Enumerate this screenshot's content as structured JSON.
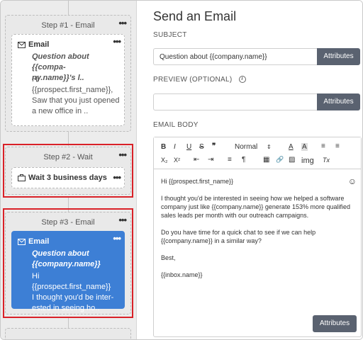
{
  "sequence": {
    "step1": {
      "header": "Step #1 - Email",
      "card_title": "Email",
      "subject_line1": "Question about {{compa-",
      "subject_line2": "ny.name}}'s l..",
      "body_line1": "Hi",
      "body_line2": "{{prospect.first_name}},",
      "body_line3": "Saw that you just opened",
      "body_line4": "a new office in .."
    },
    "step2": {
      "header": "Step #2 - Wait",
      "card_title": "Wait 3 business days"
    },
    "step3": {
      "header": "Step #3 - Email",
      "card_title": "Email",
      "subject_line1": "Question about",
      "subject_line2": "{{company.name}}",
      "body_line1": "Hi {{prospect.first_name}}",
      "body_line2": "I thought you'd be inter-",
      "body_line3": "ested in seeing ho.."
    },
    "menu_dots": "•••"
  },
  "editor": {
    "title": "Send an Email",
    "subject_label": "SUBJECT",
    "subject_value": "Question about {{company.name}}",
    "attributes_label": "Attributes",
    "preview_label": "PREVIEW (OPTIONAL)",
    "preview_value": "",
    "info_glyph": "i",
    "body_label": "EMAIL BODY",
    "toolbar": {
      "bold": "B",
      "italic": "I",
      "underline": "U",
      "strike": "S",
      "quote": "❞",
      "format_value": "Normal",
      "font_color": "A",
      "highlight": "A",
      "ordered_list": "≡",
      "bullet_list": "≡",
      "subscript": "X₂",
      "superscript": "X²",
      "outdent": "⇤",
      "indent": "⇥",
      "align": "≡",
      "rtl": "¶",
      "table": "▦",
      "link": "🔗",
      "image": "▨",
      "img_label": "img",
      "clear": "Tx"
    },
    "body": {
      "greeting": "Hi {{prospect.first_name}}",
      "para1": "I thought you'd be interested in seeing how we helped a software company just like {{company.name}} generate 153% more qualified sales leads per month with our outreach campaigns.",
      "para2": "Do you have time for a quick chat to see if we can help {{company.name}} in a similar way?",
      "signoff": "Best,",
      "signature": "{{inbox.name}}"
    },
    "smiley": "☺",
    "attributes_bottom": "Attributes"
  },
  "colors": {
    "accent_blue": "#3d7fd5",
    "highlight_red": "#d92128",
    "button_gray": "#5a6270"
  }
}
